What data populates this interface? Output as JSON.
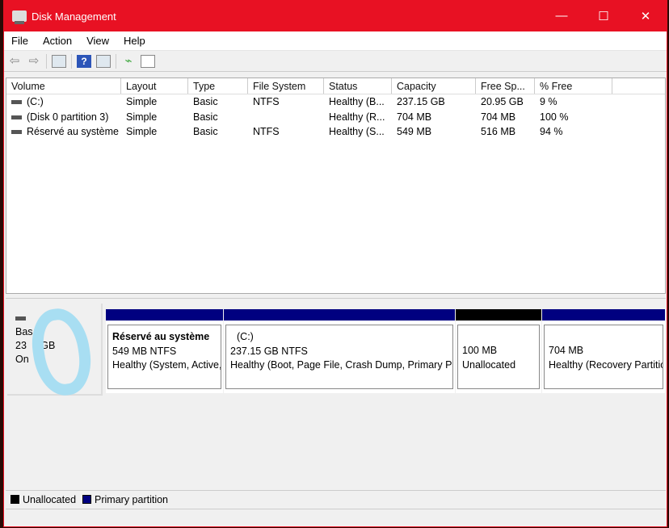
{
  "window": {
    "title": "Disk Management",
    "minimize": "—",
    "maximize": "☐",
    "close": "✕"
  },
  "menu": [
    "File",
    "Action",
    "View",
    "Help"
  ],
  "toolbar": {
    "back": "⇦",
    "forward": "⇨",
    "help": "?"
  },
  "columns": [
    "Volume",
    "Layout",
    "Type",
    "File System",
    "Status",
    "Capacity",
    "Free Sp...",
    "% Free"
  ],
  "volumes": [
    [
      "(C:)",
      "Simple",
      "Basic",
      "NTFS",
      "Healthy (B...",
      "237.15 GB",
      "20.95 GB",
      "9 %"
    ],
    [
      "(Disk 0 partition 3)",
      "Simple",
      "Basic",
      "",
      "Healthy (R...",
      "704 MB",
      "704 MB",
      "100 %"
    ],
    [
      "Réservé au système",
      "Simple",
      "Basic",
      "NTFS",
      "Healthy (S...",
      "549 MB",
      "516 MB",
      "94 %"
    ]
  ],
  "disk": {
    "type": "Bas",
    "size": "23  7 GB",
    "state": "On  e"
  },
  "partitions": [
    {
      "name": "Réservé au système",
      "size": "549 MB NTFS",
      "status": "Healthy (System, Active, Primary Partition)",
      "color": "#000080"
    },
    {
      "name": "(C:)",
      "size": "237.15 GB NTFS",
      "status": "Healthy (Boot, Page File, Crash Dump, Primary Partition)",
      "color": "#000080"
    },
    {
      "name": "",
      "size": "100 MB",
      "status": "Unallocated",
      "color": "#000000"
    },
    {
      "name": "",
      "size": "704 MB",
      "status": "Healthy (Recovery Partition)",
      "color": "#000080"
    }
  ],
  "legend": {
    "unallocated": "Unallocated",
    "primary": "Primary partition"
  }
}
